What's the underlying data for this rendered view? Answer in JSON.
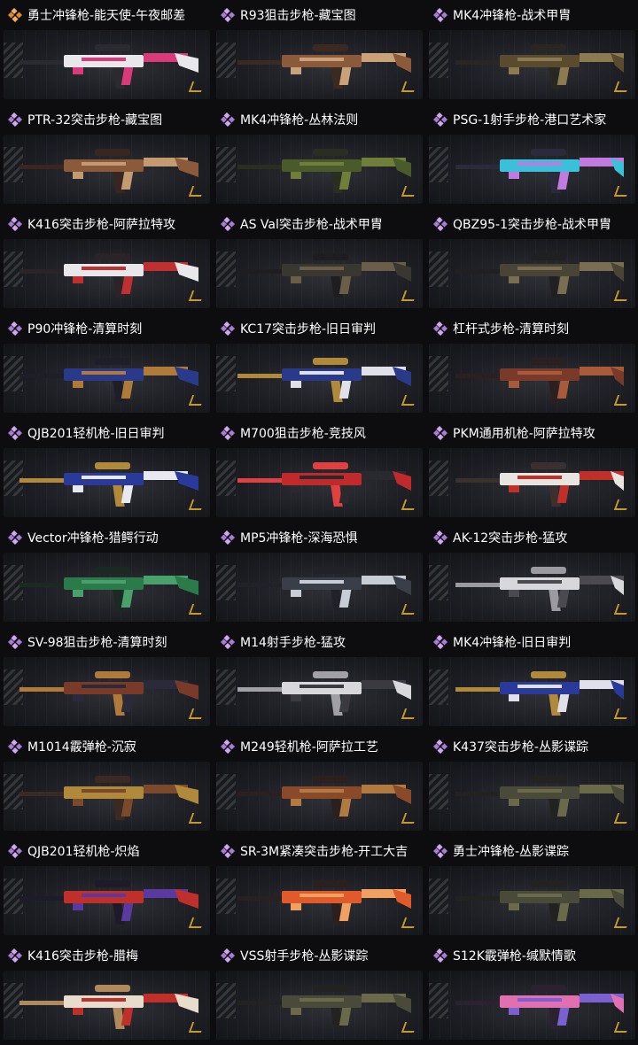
{
  "items": [
    {
      "name": "勇士冲锋枪-能天使-午夜邮差",
      "rarity": "orange",
      "colors": [
        "#e8e8ec",
        "#d83a7a",
        "#2a2a30"
      ]
    },
    {
      "name": "R93狙击步枪-藏宝图",
      "rarity": "purple",
      "colors": [
        "#8a5a3a",
        "#c9a27a",
        "#3a2a22"
      ]
    },
    {
      "name": "MK4冲锋枪-战术甲胄",
      "rarity": "purple",
      "colors": [
        "#5a4a2e",
        "#8c7a50",
        "#2a2622"
      ]
    },
    {
      "name": "PTR-32突击步枪-藏宝图",
      "rarity": "purple",
      "colors": [
        "#8a5a3a",
        "#c49a70",
        "#3a2620"
      ]
    },
    {
      "name": "MK4冲锋枪-丛林法则",
      "rarity": "purple",
      "colors": [
        "#4a5a2a",
        "#6f7f3a",
        "#2a2e20"
      ]
    },
    {
      "name": "PSG-1射手步枪-港口艺术家",
      "rarity": "purple",
      "colors": [
        "#3ac0d8",
        "#c07ae0",
        "#2a2a3a"
      ]
    },
    {
      "name": "K416突击步枪-阿萨拉特攻",
      "rarity": "purple",
      "colors": [
        "#e8e8ea",
        "#c03030",
        "#2a2428"
      ]
    },
    {
      "name": "AS Val突击步枪-战术甲胄",
      "rarity": "purple",
      "colors": [
        "#3a3630",
        "#6a5e48",
        "#1e1e20"
      ]
    },
    {
      "name": "QBZ95-1突击步枪-战术甲胄",
      "rarity": "purple",
      "colors": [
        "#4a4436",
        "#7a6e52",
        "#202022"
      ]
    },
    {
      "name": "P90冲锋枪-清算时刻",
      "rarity": "purple",
      "colors": [
        "#2a3a8a",
        "#b07a3a",
        "#1e1e28"
      ]
    },
    {
      "name": "KC17突击步枪-旧日审判",
      "rarity": "purple",
      "colors": [
        "#2a3a8a",
        "#e0e0e8",
        "#b08a3a"
      ]
    },
    {
      "name": "杠杆式步枪-清算时刻",
      "rarity": "purple",
      "colors": [
        "#7a3a2a",
        "#a85a3a",
        "#2a2020"
      ]
    },
    {
      "name": "QJB201轻机枪-旧日审判",
      "rarity": "purple",
      "colors": [
        "#2a3a9a",
        "#e8e8f0",
        "#b08a3a"
      ]
    },
    {
      "name": "M700狙击步枪-竞技风",
      "rarity": "purple",
      "colors": [
        "#c02a2a",
        "#2a2a2e",
        "#e04040"
      ]
    },
    {
      "name": "PKM通用机枪-阿萨拉特攻",
      "rarity": "purple",
      "colors": [
        "#e8e4e0",
        "#c03028",
        "#3a3030"
      ]
    },
    {
      "name": "Vector冲锋枪-猎鳄行动",
      "rarity": "purple",
      "colors": [
        "#2a7a4a",
        "#4aa06a",
        "#1a2a22"
      ]
    },
    {
      "name": "MP5冲锋枪-深海恐惧",
      "rarity": "purple",
      "colors": [
        "#3a3e48",
        "#c8ccd4",
        "#202228"
      ]
    },
    {
      "name": "AK-12突击步枪-猛攻",
      "rarity": "purple",
      "colors": [
        "#d8d8dc",
        "#4a4a50",
        "#9a9aa0"
      ]
    },
    {
      "name": "SV-98狙击步枪-清算时刻",
      "rarity": "purple",
      "colors": [
        "#7a3a2a",
        "#2a2a3a",
        "#b07a3a"
      ]
    },
    {
      "name": "M14射手步枪-猛攻",
      "rarity": "purple",
      "colors": [
        "#d8d8dc",
        "#3a3a40",
        "#a0a0a6"
      ]
    },
    {
      "name": "MK4冲锋枪-旧日审判",
      "rarity": "purple",
      "colors": [
        "#2a3a9a",
        "#e0e0ea",
        "#b08a3a"
      ]
    },
    {
      "name": "M1014霰弹枪-沉寂",
      "rarity": "purple",
      "colors": [
        "#b08a3a",
        "#7a4a2a",
        "#3a2a22"
      ]
    },
    {
      "name": "M249轻机枪-阿萨拉工艺",
      "rarity": "purple",
      "colors": [
        "#8a4a2a",
        "#b07a40",
        "#2a2020"
      ]
    },
    {
      "name": "K437突击步枪-丛影谍踪",
      "rarity": "purple",
      "colors": [
        "#4a4a3a",
        "#6a6a4a",
        "#222220"
      ]
    },
    {
      "name": "QJB201轻机枪-炽焰",
      "rarity": "purple",
      "colors": [
        "#c0302a",
        "#5a3aa0",
        "#1e1a28"
      ]
    },
    {
      "name": "SR-3M紧凑突击步枪-开工大吉",
      "rarity": "purple",
      "colors": [
        "#e05a2a",
        "#f0a060",
        "#2a2020"
      ]
    },
    {
      "name": "勇士冲锋枪-丛影谍踪",
      "rarity": "purple",
      "colors": [
        "#4a4a3a",
        "#6a6a4a",
        "#222220"
      ]
    },
    {
      "name": "K416突击步枪-腊梅",
      "rarity": "purple",
      "colors": [
        "#e8dccc",
        "#c0302a",
        "#b08a5a"
      ]
    },
    {
      "name": "VSS射手步枪-丛影谍踪",
      "rarity": "purple",
      "colors": [
        "#4a4a3a",
        "#6a6a4a",
        "#222220"
      ]
    },
    {
      "name": "S12K霰弹枪-缄默情歌",
      "rarity": "purple",
      "colors": [
        "#e070b0",
        "#7a60d0",
        "#2a2230"
      ]
    }
  ]
}
